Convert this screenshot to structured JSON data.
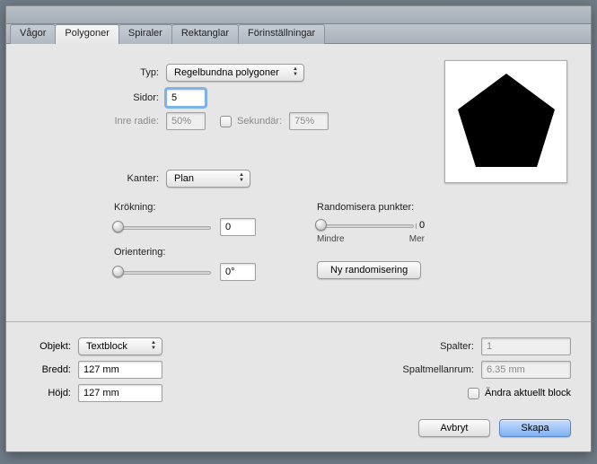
{
  "tabs": {
    "waves": "Vågor",
    "polygons": "Polygoner",
    "spirals": "Spiraler",
    "rectangles": "Rektanglar",
    "presets": "Förinställningar"
  },
  "panel": {
    "type_label": "Typ:",
    "type_value": "Regelbundna polygoner",
    "sides_label": "Sidor:",
    "sides_value": "5",
    "inner_radius_label": "Inre radie:",
    "inner_radius_value": "50%",
    "secondary_label": "Sekundär:",
    "secondary_value": "75%",
    "edges_label": "Kanter:",
    "edges_value": "Plan",
    "curvature_label": "Krökning:",
    "curvature_value": "0",
    "orientation_label": "Orientering:",
    "orientation_value": "0°",
    "randomize_label": "Randomisera punkter:",
    "randomize_value": "0",
    "randomize_less": "Mindre",
    "randomize_more": "Mer",
    "new_random_btn": "Ny randomisering"
  },
  "bottom": {
    "object_label": "Objekt:",
    "object_value": "Textblock",
    "width_label": "Bredd:",
    "width_value": "127 mm",
    "height_label": "Höjd:",
    "height_value": "127 mm",
    "columns_label": "Spalter:",
    "columns_value": "1",
    "gutter_label": "Spaltmellanrum:",
    "gutter_value": "6.35 mm",
    "modify_label": "Ändra aktuellt block",
    "cancel_btn": "Avbryt",
    "create_btn": "Skapa"
  },
  "preview": {
    "sides": 5
  }
}
